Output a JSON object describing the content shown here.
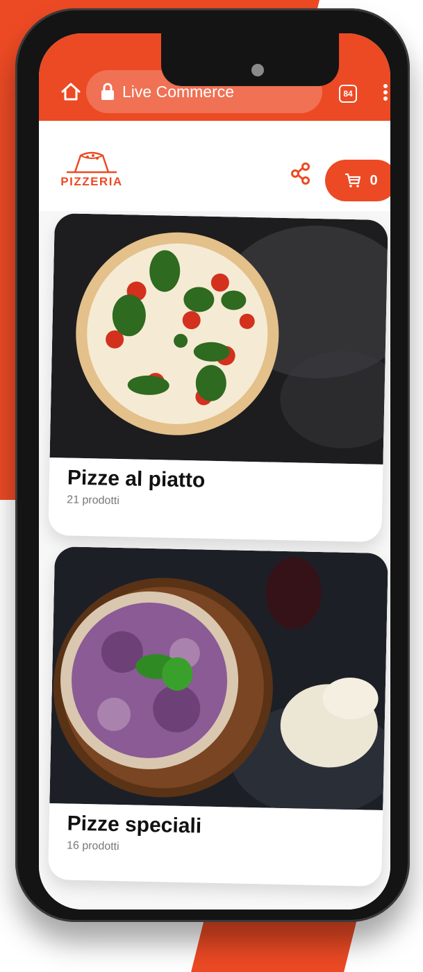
{
  "browser": {
    "url_label": "Live Commerce",
    "tab_count": "84"
  },
  "header": {
    "logo_text": "PIZZERIA",
    "cart_count": "0"
  },
  "categories": [
    {
      "title": "Pizze al piatto",
      "subtitle": "21 prodotti"
    },
    {
      "title": "Pizze speciali",
      "subtitle": "16 prodotti"
    }
  ],
  "colors": {
    "accent": "#ec4a24",
    "phone_frame": "#141414"
  },
  "icons": [
    "home-icon",
    "lock-icon",
    "tabs-icon",
    "more-vert-icon",
    "share-icon",
    "cart-icon"
  ]
}
